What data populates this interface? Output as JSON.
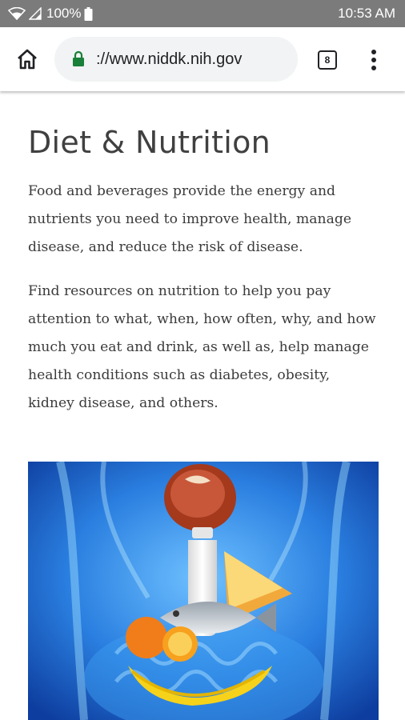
{
  "status_bar": {
    "battery_percent": "100%",
    "time": "10:53 AM"
  },
  "browser": {
    "url": "://www.niddk.nih.gov",
    "tab_count": "8"
  },
  "page": {
    "title": "Diet & Nutrition",
    "paragraph_1": "Food and beverages provide the energy and nutrients you need to improve health, manage disease, and reduce the risk of disease.",
    "paragraph_2": "Find resources on nutrition to help you pay attention to what, when, how often, why, and how much you eat and drink, as well as, help manage health conditions such as diabetes, obesity, kidney disease, and others."
  },
  "icons": {
    "home": "home-icon",
    "lock": "lock-icon",
    "tabs": "tab-switcher-icon",
    "menu": "overflow-menu-icon",
    "wifi": "wifi-icon",
    "signal": "signal-icon",
    "battery": "battery-icon"
  },
  "colors": {
    "status_bar": "#7b7b7b",
    "lock_green": "#188038",
    "url_pill": "#f1f3f4",
    "hero_blue": "#1f6fd1"
  }
}
